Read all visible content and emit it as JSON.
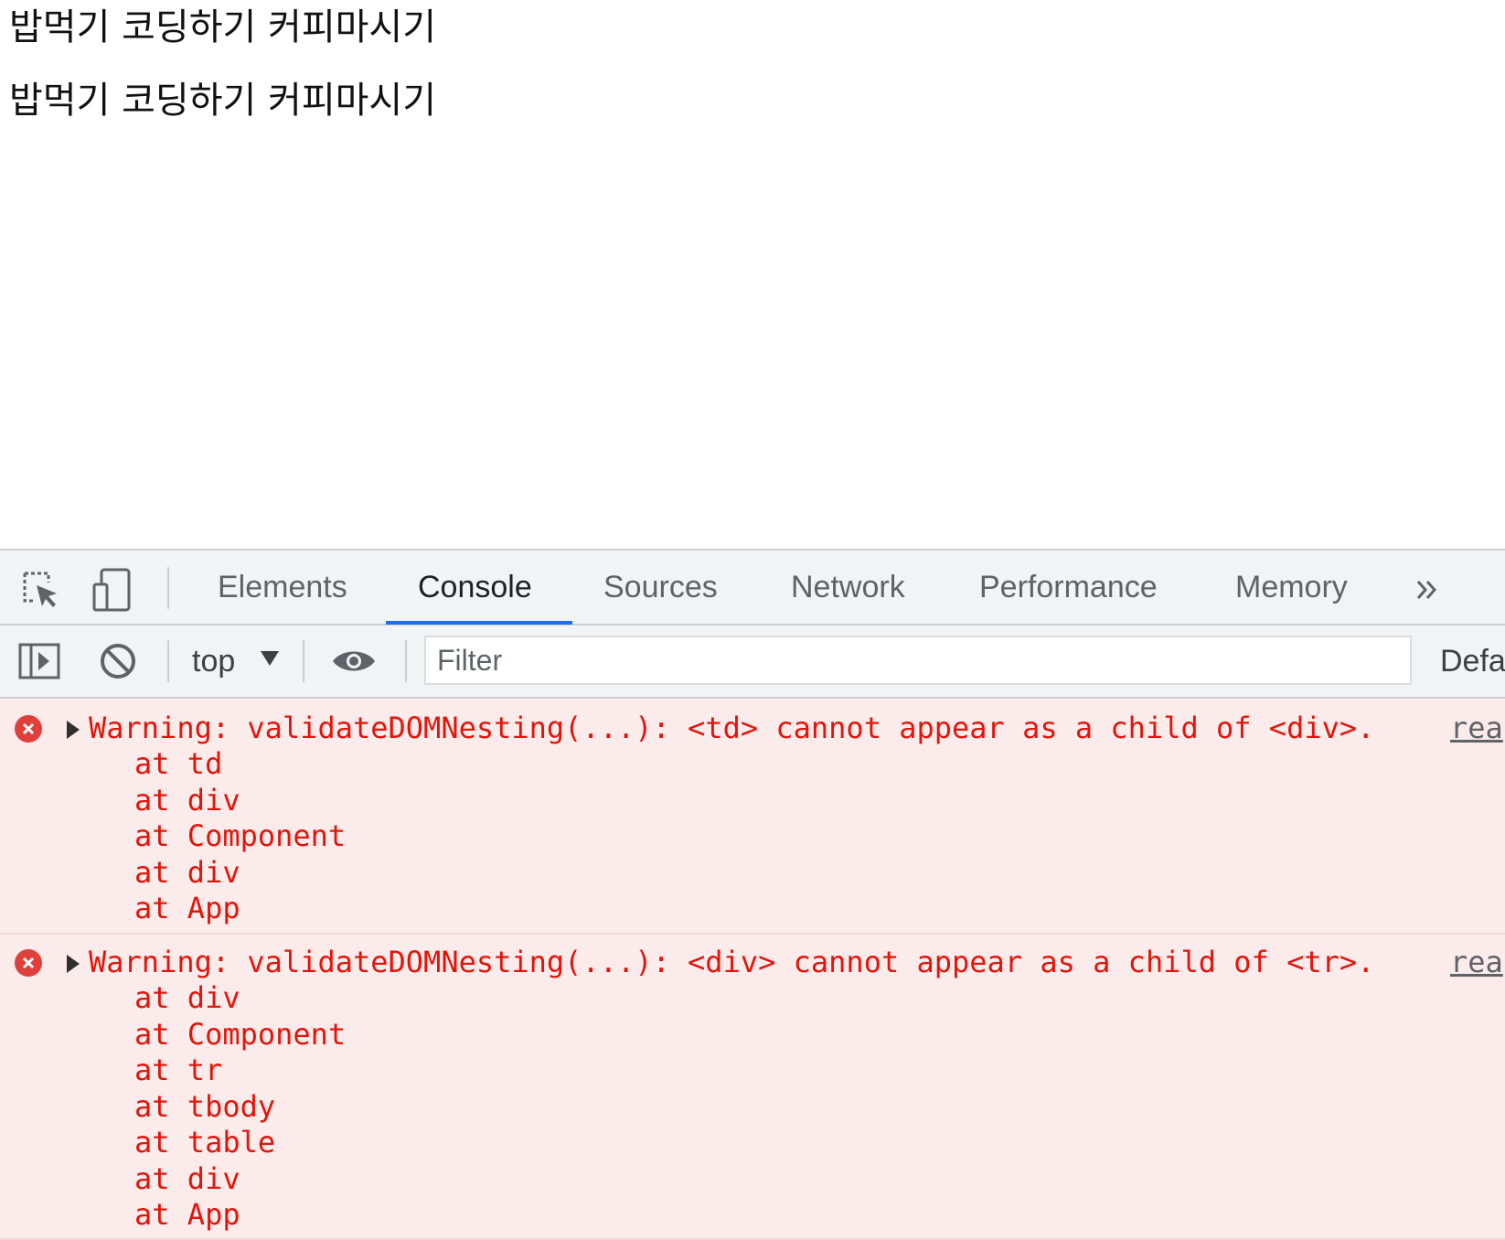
{
  "page": {
    "lines": [
      "밥먹기 코딩하기 커피마시기",
      "밥먹기 코딩하기 커피마시기"
    ]
  },
  "devtools": {
    "icons": {
      "inspect": "inspect-element-icon",
      "device": "device-toolbar-icon",
      "more_tabs": "chevron-double-right-icon"
    },
    "tabs": [
      {
        "label": "Elements",
        "active": false
      },
      {
        "label": "Console",
        "active": true
      },
      {
        "label": "Sources",
        "active": false
      },
      {
        "label": "Network",
        "active": false
      },
      {
        "label": "Performance",
        "active": false
      },
      {
        "label": "Memory",
        "active": false
      }
    ],
    "more_tabs_label": "»",
    "accent_color": "#1a73e8",
    "toolbar": {
      "sidebar_icon": "console-sidebar-icon",
      "clear_icon": "clear-console-icon",
      "context": "top",
      "eye_icon": "live-expression-eye-icon",
      "filter_placeholder": "Filter",
      "levels": "Defa"
    },
    "console": {
      "error_color": "#e3150b",
      "error_bg": "#fcebeb",
      "messages": [
        {
          "text": "Warning: validateDOMNesting(...): <td> cannot appear as a child of <div>.",
          "source": "rea",
          "stack": [
            "at td",
            "at div",
            "at Component",
            "at div",
            "at App"
          ]
        },
        {
          "text": "Warning: validateDOMNesting(...): <div> cannot appear as a child of <tr>.",
          "source": "rea",
          "stack": [
            "at div",
            "at Component",
            "at tr",
            "at tbody",
            "at table",
            "at div",
            "at App"
          ]
        }
      ]
    }
  }
}
